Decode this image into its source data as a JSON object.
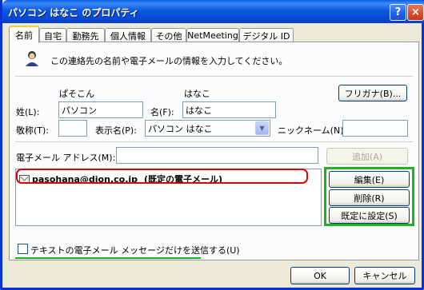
{
  "window": {
    "title": "パソコン はなこ のプロパティ",
    "help_glyph": "?",
    "close_glyph": "×"
  },
  "tabs": [
    {
      "label": "名前",
      "active": true
    },
    {
      "label": "自宅"
    },
    {
      "label": "勤務先"
    },
    {
      "label": "個人情報"
    },
    {
      "label": "その他"
    },
    {
      "label": "NetMeeting"
    },
    {
      "label": "デジタル ID"
    }
  ],
  "intro_text": "この連絡先の名前や電子メールの情報を入力してください。",
  "name": {
    "last_reading": "ぱそこん",
    "first_reading": "はなこ",
    "last_label": "姓(L):",
    "last_value": "パソコン",
    "first_label": "名(F):",
    "first_value": "はなこ",
    "furigana_button": "フリガナ(B)...",
    "title_label": "敬称(T):",
    "title_value": "",
    "display_label": "表示名(P):",
    "display_value": "パソコン はなこ",
    "nickname_label": "ニックネーム(N):",
    "nickname_value": ""
  },
  "email": {
    "label": "電子メール アドレス(M):",
    "input_value": "",
    "add_button": "追加(A)",
    "list": [
      {
        "address": "pasohana@dion.co.jp",
        "note": "(既定の電子メール)"
      }
    ],
    "edit_button": "編集(E)",
    "delete_button": "削除(R)",
    "default_button": "既定に設定(S)",
    "text_only_label": "テキストの電子メール メッセージだけを送信する(U)"
  },
  "footer": {
    "ok": "OK",
    "cancel": "キャンセル"
  },
  "colors": {
    "title_bar": "#0a5fe6",
    "highlight_red": "#e00000",
    "highlight_green": "#1bb41b"
  }
}
